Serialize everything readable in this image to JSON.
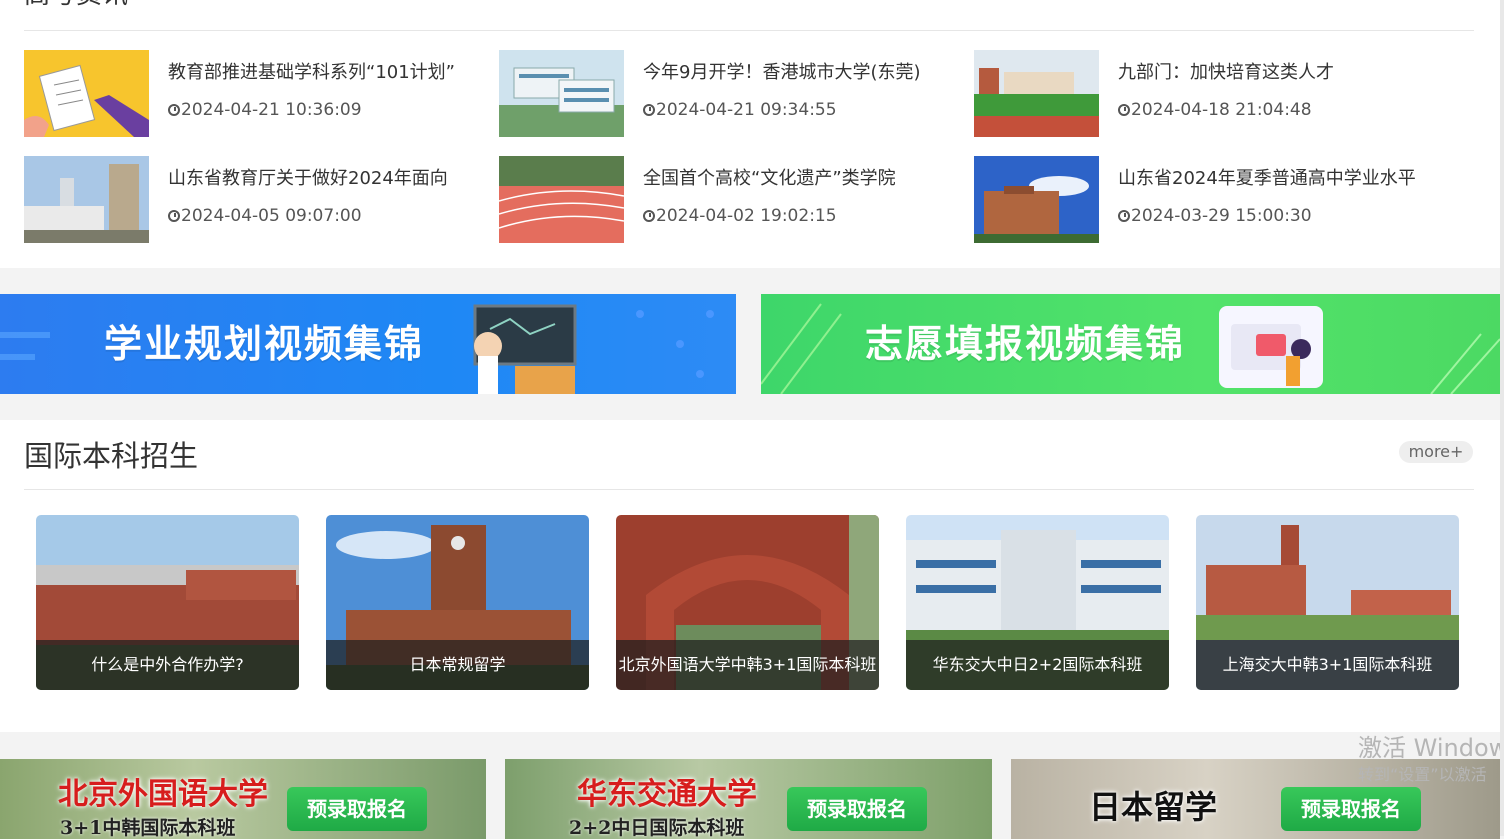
{
  "news": {
    "title": "高考资讯",
    "items": [
      {
        "headline": "教育部推进基础学科系列“101计划”",
        "date": "2024-04-21 10:36:09"
      },
      {
        "headline": "今年9月开学！香港城市大学(东莞)",
        "date": "2024-04-21 09:34:55"
      },
      {
        "headline": "九部门：加快培育这类人才",
        "date": "2024-04-18 21:04:48"
      },
      {
        "headline": "山东省教育厅关于做好2024年面向",
        "date": "2024-04-05 09:07:00"
      },
      {
        "headline": "全国首个高校“文化遗产”类学院",
        "date": "2024-04-02 19:02:15"
      },
      {
        "headline": "山东省2024年夏季普通高中学业水平",
        "date": "2024-03-29 15:00:30"
      }
    ]
  },
  "banners": {
    "plan": "学业规划视频集锦",
    "fill": "志愿填报视频集锦"
  },
  "intl": {
    "title": "国际本科招生",
    "more": "more+",
    "cards": [
      {
        "caption": "什么是中外合作办学?"
      },
      {
        "caption": "日本常规留学"
      },
      {
        "caption": "北京外国语大学中韩3+1国际本科班"
      },
      {
        "caption": "华东交大中日2+2国际本科班"
      },
      {
        "caption": "上海交大中韩3+1国际本科班"
      }
    ]
  },
  "promos": [
    {
      "title": "北京外国语大学",
      "subtitle": "3+1中韩国际本科班",
      "button": "预录取报名"
    },
    {
      "title": "华东交通大学",
      "subtitle": "2+2中日国际本科班",
      "button": "预录取报名"
    },
    {
      "title": "日本留学",
      "subtitle": "",
      "button": "预录取报名"
    }
  ],
  "watermark": {
    "title": "激活 Windows",
    "subtitle": "转到“设置”以激活"
  },
  "icons": {
    "date": "clock-icon"
  }
}
